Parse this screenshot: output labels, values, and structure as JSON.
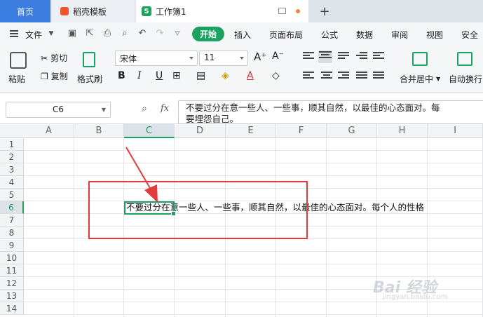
{
  "tabs": {
    "home": "首页",
    "template": "稻壳模板",
    "workbook": "工作簿1",
    "add": "+"
  },
  "menu": {
    "file": "文件",
    "start": "开始",
    "items": [
      "插入",
      "页面布局",
      "公式",
      "数据",
      "审阅",
      "视图",
      "安全"
    ]
  },
  "ribbon": {
    "paste": "粘贴",
    "cut": "剪切",
    "copy": "复制",
    "format_painter": "格式刷",
    "font_name": "宋体",
    "font_size": "11",
    "bold": "B",
    "italic": "I",
    "underline": "U",
    "merge_center": "合并居中",
    "wrap_text": "自动换行"
  },
  "formula_bar": {
    "name_box": "C6",
    "fx": "fx",
    "content": "不要过分在意一些人、一些事，顺其自然，以最佳的心态面对。每个人的性格不同，所以不要埋怨自己。"
  },
  "formula_display": {
    "line1": "不要过分在意一些人、一些事，顺其自然，以最佳的心态面对。每",
    "line2": "要埋怨自己。"
  },
  "grid": {
    "columns": [
      "A",
      "B",
      "C",
      "D",
      "E",
      "F",
      "G",
      "H",
      "I"
    ],
    "rows": [
      "1",
      "2",
      "3",
      "4",
      "5",
      "6",
      "7",
      "8",
      "9",
      "10",
      "11",
      "12",
      "13",
      "14"
    ],
    "selected_column": "C",
    "selected_row": "6",
    "cell_C6": "不要过分在意一些人、一些事，顺其自然，以最佳的心态面对。每个人的性格"
  },
  "watermark": {
    "text": "Bai 经验",
    "sub": "jingyan.baidu.com"
  },
  "colors": {
    "accent_green": "#1aa260",
    "tab_blue": "#3b7de1",
    "annotation_red": "#e23b3b"
  }
}
